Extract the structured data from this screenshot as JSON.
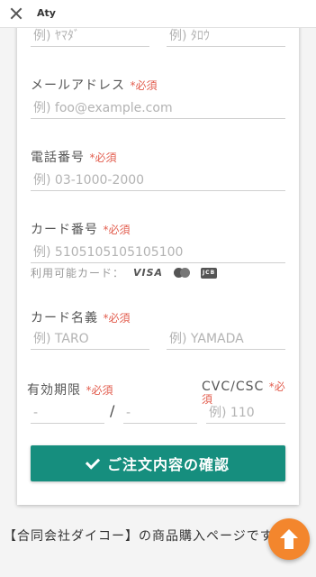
{
  "topbar": {
    "title": "Aty"
  },
  "form": {
    "name_kana": {
      "last_placeholder": "例) ﾔﾏﾀﾞ",
      "first_placeholder": "例) ﾀﾛｳ"
    },
    "email": {
      "label": "メールアドレス",
      "required": "*必須",
      "placeholder": "例) foo@example.com"
    },
    "phone": {
      "label": "電話番号",
      "required": "*必須",
      "placeholder": "例) 03-1000-2000"
    },
    "card_number": {
      "label": "カード番号",
      "required": "*必須",
      "placeholder": "例) 5105105105105100",
      "available_label": "利用可能カード：",
      "brands": {
        "visa": "VISA",
        "jcb": "JCB"
      }
    },
    "card_name": {
      "label": "カード名義",
      "required": "*必須",
      "first_placeholder": "例) TARO",
      "last_placeholder": "例) YAMADA"
    },
    "expiry": {
      "label": "有効期限",
      "required": "*必須",
      "month_placeholder": "-",
      "separator": "/",
      "year_placeholder": "-"
    },
    "cvc": {
      "label": "CVC/CSC",
      "required": "*必須",
      "placeholder": "例) 110"
    },
    "submit_label": "ご注文内容の確認"
  },
  "footer": {
    "text": "【合同会社ダイコー】の商品購入ページです。"
  },
  "colors": {
    "accent": "#168e7e",
    "required": "#e25d4e",
    "fab": "#f3862d"
  },
  "icons": {
    "close": "close-icon",
    "check": "check-icon",
    "scroll_top": "arrow-up-icon"
  }
}
